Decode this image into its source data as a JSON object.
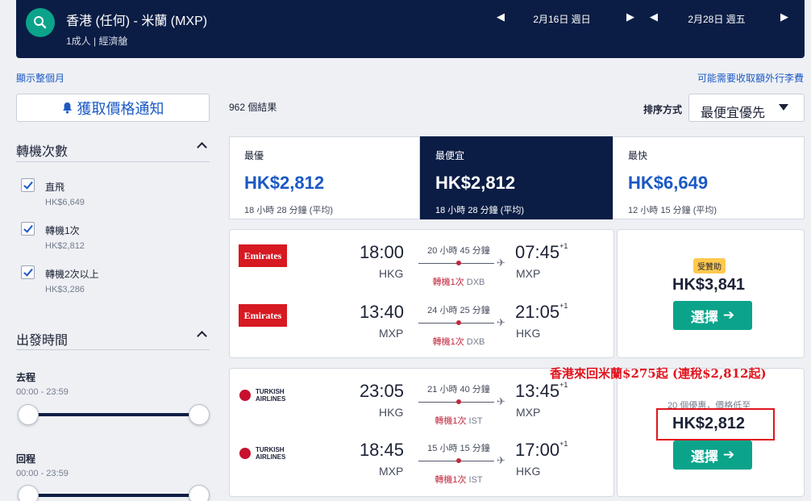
{
  "header": {
    "route": "香港 (任何) - 米蘭 (MXP)",
    "passengers": "1成人 | 經濟艙",
    "depart_date": "2月16日 週日",
    "return_date": "2月28日 週五"
  },
  "links": {
    "show_month": "顯示整個月",
    "extra_fees": "可能需要收取額外行李費"
  },
  "sidebar": {
    "price_alert": "獲取價格通知",
    "stops_title": "轉機次數",
    "stops": [
      {
        "label": "直飛",
        "price": "HK$6,649"
      },
      {
        "label": "轉機1次",
        "price": "HK$2,812"
      },
      {
        "label": "轉機2次以上",
        "price": "HK$3,286"
      }
    ],
    "times_title": "出發時間",
    "outbound_label": "去程",
    "outbound_range": "00:00 - 23:59",
    "return_label": "回程",
    "return_range": "00:00 - 23:59"
  },
  "results": {
    "count": "962 個結果",
    "sort_label": "排序方式",
    "sort_value": "最便宜優先"
  },
  "tabs": [
    {
      "label": "最優",
      "price": "HK$2,812",
      "duration": "18 小時 28 分鐘 (平均)"
    },
    {
      "label": "最便宜",
      "price": "HK$2,812",
      "duration": "18 小時 28 分鐘 (平均)"
    },
    {
      "label": "最快",
      "price": "HK$6,649",
      "duration": "12 小時 15 分鐘 (平均)"
    }
  ],
  "itineraries": [
    {
      "airline": "Emirates",
      "legs": [
        {
          "dep_time": "18:00",
          "dep_code": "HKG",
          "duration": "20 小時 45 分鐘",
          "stops": "轉機1次",
          "hub": "DXB",
          "arr_time": "07:45",
          "arr_plus": "+1",
          "arr_code": "MXP"
        },
        {
          "dep_time": "13:40",
          "dep_code": "MXP",
          "duration": "24 小時 25 分鐘",
          "stops": "轉機1次",
          "hub": "DXB",
          "arr_time": "21:05",
          "arr_plus": "+1",
          "arr_code": "HKG"
        }
      ],
      "badge": "受贊助",
      "price": "HK$3,841",
      "select": "選擇"
    },
    {
      "airline": "TURKISH AIRLINES",
      "legs": [
        {
          "dep_time": "23:05",
          "dep_code": "HKG",
          "duration": "21 小時 40 分鐘",
          "stops": "轉機1次",
          "hub": "IST",
          "arr_time": "13:45",
          "arr_plus": "+1",
          "arr_code": "MXP"
        },
        {
          "dep_time": "18:45",
          "dep_code": "MXP",
          "duration": "15 小時 15 分鐘",
          "stops": "轉機1次",
          "hub": "IST",
          "arr_time": "17:00",
          "arr_plus": "+1",
          "arr_code": "HKG"
        }
      ],
      "deal_note": "20 個優惠，價格低至",
      "price": "HK$2,812",
      "select": "選擇"
    }
  ],
  "annotation": "香港來回米蘭$275起 (連稅$2,812起)",
  "colors": {
    "navy": "#0b1d45",
    "teal": "#0ca38b",
    "blue": "#1b59c5",
    "red": "#e0141e"
  }
}
